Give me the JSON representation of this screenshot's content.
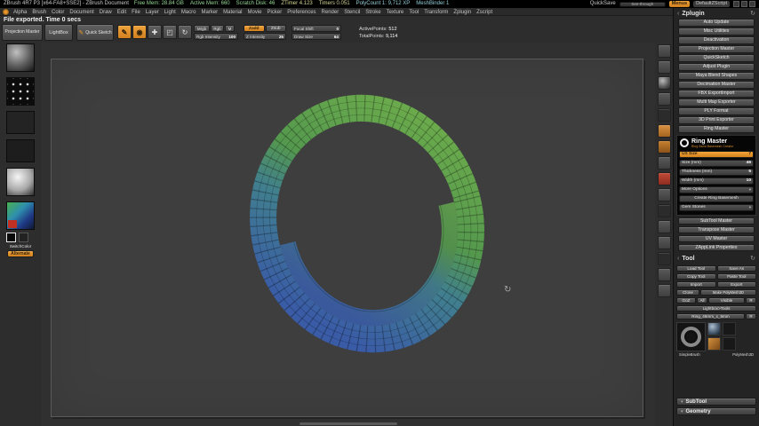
{
  "colors": {
    "accent_orange": "#E8962E",
    "ring_green": "#5FA04B",
    "ring_blue": "#3B62A8",
    "canvas_bg": "#3E3E3E"
  },
  "icons": {
    "chevron_left": "‹",
    "chevron_down": "▾",
    "refresh": "↻",
    "orbit": "↻",
    "pencil": "✎",
    "draw_dot": "◉",
    "move_cross": "✚",
    "scale_box": "◰",
    "rotate_arrow": "↻"
  },
  "title_bar": {
    "app_title": "ZBrush 4R7 P3 [x64-FA8+SSE2] - ZBrush Document",
    "stats": [
      "Free Mem: 28.84 GB",
      "Active Mem: 660",
      "Scratch Disk: 46",
      "ZTimer 4.123",
      "Timers 0.051",
      "PolyCount 1: 9,712 XP",
      "MeshBinder 1"
    ],
    "quicksave": "QuickSave",
    "see_through": "See-through",
    "menus_toggle": "Menus",
    "default_zscript": "DefaultZScript"
  },
  "menu_bar": {
    "items": [
      "Alpha",
      "Brush",
      "Color",
      "Document",
      "Draw",
      "Edit",
      "File",
      "Layer",
      "Light",
      "Macro",
      "Marker",
      "Material",
      "Movie",
      "Picker",
      "Preferences",
      "Render",
      "Stencil",
      "Stroke",
      "Texture",
      "Tool",
      "Transform",
      "Zplugin",
      "Zscript"
    ]
  },
  "status_message": "File exported. Time 0 secs",
  "toolbar": {
    "projection_master": "Projection Master",
    "lightbox": "LightBox",
    "quick_sketch": "Quick Sketch",
    "mrgb": "Mrgb",
    "rgb": "Rgb",
    "m": "M",
    "zadd": "Zadd",
    "zsub": "Zsub",
    "rgb_intensity": {
      "label": "Rgb Intensity",
      "value": "100"
    },
    "z_intensity": {
      "label": "Z Intensity",
      "value": "25"
    },
    "focal_shift": {
      "label": "Focal Shift",
      "value": "0"
    },
    "draw_size": {
      "label": "Draw Size",
      "value": "64"
    },
    "active_points": {
      "label": "ActivePoints:",
      "value": "512"
    },
    "total_points": {
      "label": "TotalPoints:",
      "value": "9,114"
    }
  },
  "left_shelf": {
    "switch_color": "SwitchColor",
    "alternate": "Alternate"
  },
  "zplugin": {
    "title": "Zplugin",
    "items": [
      "Auto Update",
      "Misc Utilities",
      "Deactivation",
      "Projection Master",
      "QuickSketch",
      "Adjust Plugin",
      "Maya Blend Shapes",
      "Decimation Master",
      "FBX ExportImport",
      "Multi Map Exporter",
      "PLY Format",
      "3D Print Exporter"
    ],
    "ring_master_item": "Ring Master",
    "ring_master": {
      "name": "Ring Master",
      "tagline": "Ring Band Basemesh Creator",
      "us_size": {
        "label": "US Size",
        "value": "7"
      },
      "size_mm": {
        "label": "Size (mm)",
        "value": "46"
      },
      "thickness_mm": {
        "label": "Thickness (mm)",
        "value": "5"
      },
      "width_mm": {
        "label": "Width (mm)",
        "value": "10"
      },
      "more_options": "More Options",
      "create_button": "Create Ring Basemesh",
      "gem_stones": "Gem Stones"
    },
    "items_after": [
      "SubTool Master",
      "Transpose Master",
      "UV Master",
      "ZAppLink Properties"
    ]
  },
  "tool": {
    "title": "Tool",
    "buttons": {
      "load_tool": "Load Tool",
      "save_as": "Save As",
      "copy_tool": "Copy Tool",
      "paste_tool": "Paste Tool",
      "import": "Import",
      "export": "Export",
      "clone": "Clone",
      "make_polymesh3d": "Make PolyMesh3D",
      "goz": "GoZ",
      "all": "All",
      "visible": "Visible",
      "r": "R",
      "lightbox_tools": "Lightbox>Tools",
      "current_tool_name": "Ring_46mm_x_5mm"
    },
    "recent_labels": [
      "SimpleBrush",
      "PolyMesh3D"
    ],
    "subtool": "SubTool",
    "geometry": "Geometry"
  }
}
